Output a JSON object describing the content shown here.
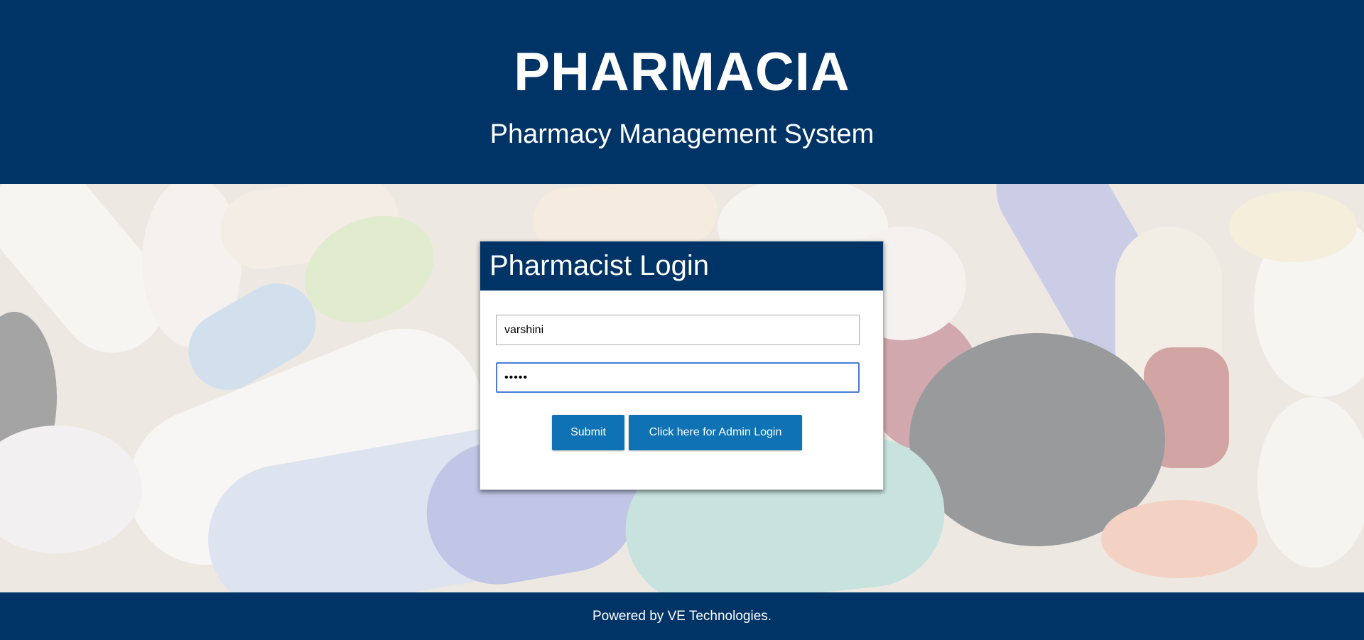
{
  "header": {
    "title": "PHARMACIA",
    "subtitle": "Pharmacy Management System"
  },
  "login": {
    "heading": "Pharmacist Login",
    "username_value": "varshini",
    "password_value": "•••••",
    "submit_label": "Submit",
    "admin_label": "Click here for Admin Login"
  },
  "footer": {
    "text": "Powered by VE Technologies."
  },
  "colors": {
    "brand_navy": "#003366",
    "button_blue": "#0e72b4",
    "focus_border": "#4a7bd6"
  }
}
